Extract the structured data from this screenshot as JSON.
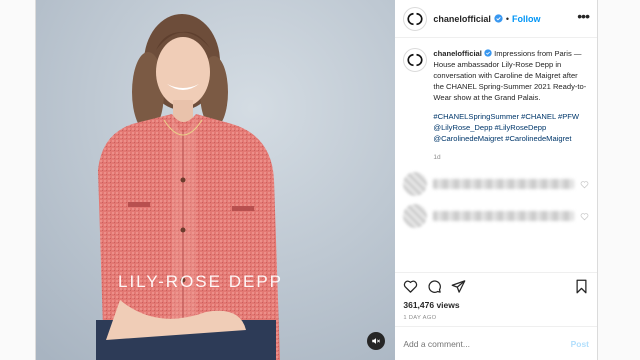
{
  "media": {
    "overlay_text": "LILY-ROSE DEPP",
    "mute_icon": "speaker-muted-icon"
  },
  "header": {
    "username": "chanelofficial",
    "separator": "•",
    "follow_label": "Follow",
    "more_icon": "more-horizontal-icon",
    "verified_icon": "verified-badge-icon"
  },
  "caption": {
    "username": "chanelofficial",
    "text": "Impressions from Paris — House ambassador Lily-Rose Depp in conversation with Caroline de Maigret after the CHANEL Spring-Summer 2021 Ready-to-Wear show at the Grand Palais.",
    "hashtags": "#CHANELSpringSummer #CHANEL #PFW @LilyRose_Depp #LilyRoseDepp @CarolinedeMaigret #CarolinedeMaigret",
    "age": "1d"
  },
  "actions": {
    "like_icon": "heart-icon",
    "comment_icon": "comment-icon",
    "share_icon": "paper-plane-icon",
    "save_icon": "bookmark-icon",
    "views": "361,476 views",
    "date": "1 DAY AGO"
  },
  "comment_box": {
    "placeholder": "Add a comment...",
    "post_label": "Post"
  },
  "colors": {
    "link": "#00376b",
    "follow": "#0095f6",
    "muted": "#8e8e8e",
    "cardigan": "#e27470"
  }
}
